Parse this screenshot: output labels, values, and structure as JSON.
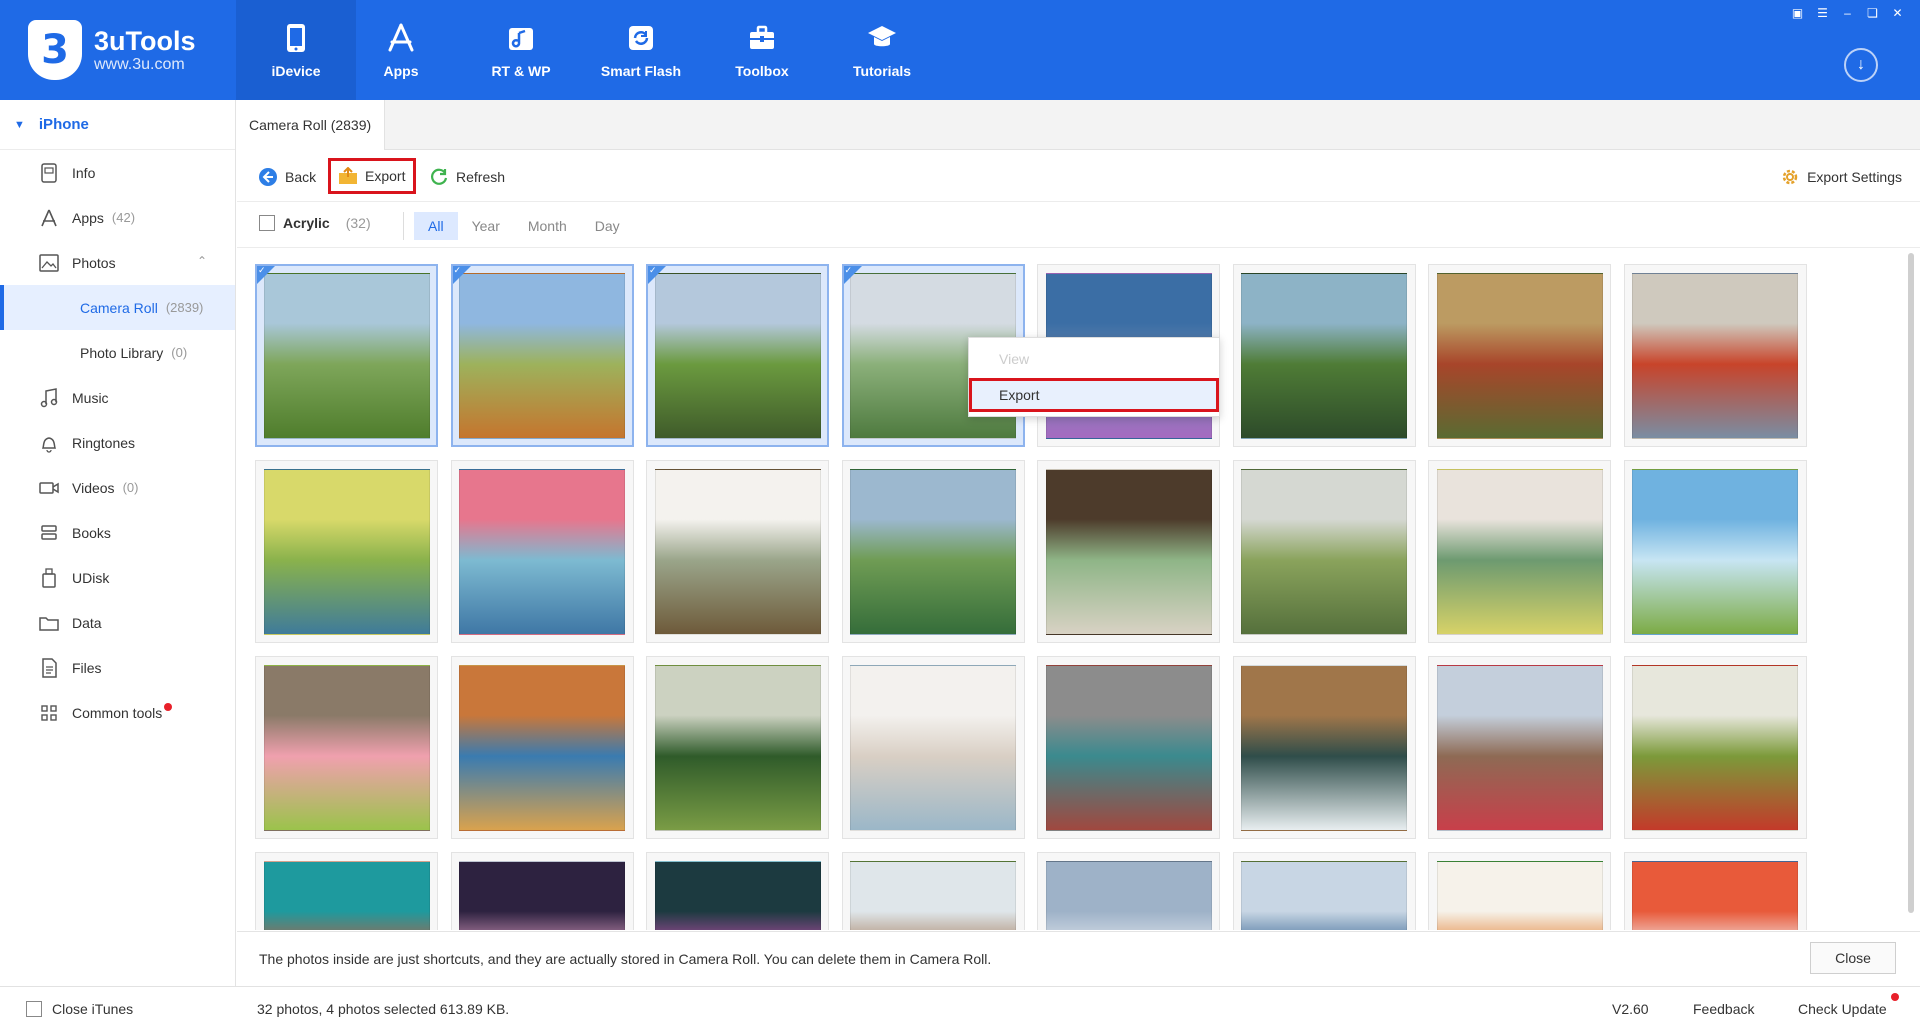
{
  "app": {
    "name": "3uTools",
    "url": "www.3u.com",
    "logo_glyph": "3",
    "brand_color": "#1f6ae6"
  },
  "nav": [
    {
      "label": "iDevice",
      "icon": "phone-icon",
      "active": true
    },
    {
      "label": "Apps",
      "icon": "app-store-icon"
    },
    {
      "label": "RT & WP",
      "icon": "ringtone-wallpaper-icon"
    },
    {
      "label": "Smart Flash",
      "icon": "flash-icon"
    },
    {
      "label": "Toolbox",
      "icon": "toolbox-icon"
    },
    {
      "label": "Tutorials",
      "icon": "graduation-cap-icon"
    }
  ],
  "sidebar": {
    "device": "iPhone",
    "items": [
      {
        "label": "Info",
        "count": "",
        "icon": "info-icon"
      },
      {
        "label": "Apps",
        "count": "(42)",
        "icon": "apps-icon"
      },
      {
        "label": "Photos",
        "count": "",
        "icon": "photos-icon"
      },
      {
        "label": "Camera Roll",
        "count": "(2839)"
      },
      {
        "label": "Photo Library",
        "count": "(0)"
      },
      {
        "label": "Music",
        "count": "",
        "icon": "music-icon"
      },
      {
        "label": "Ringtones",
        "count": "",
        "icon": "bell-icon"
      },
      {
        "label": "Videos",
        "count": "(0)",
        "icon": "video-icon"
      },
      {
        "label": "Books",
        "count": "",
        "icon": "book-icon"
      },
      {
        "label": "UDisk",
        "count": "",
        "icon": "udisk-icon"
      },
      {
        "label": "Data",
        "count": "",
        "icon": "folder-icon"
      },
      {
        "label": "Files",
        "count": "",
        "icon": "file-icon"
      },
      {
        "label": "Common tools",
        "count": "",
        "icon": "grid-icon"
      }
    ]
  },
  "tab": {
    "label": "Camera Roll (2839)"
  },
  "toolbar": {
    "back": "Back",
    "export": "Export",
    "refresh": "Refresh",
    "export_settings": "Export Settings"
  },
  "filter": {
    "album": "Acrylic",
    "count": "(32)",
    "segments": [
      "All",
      "Year",
      "Month",
      "Day"
    ],
    "active_segment": "All"
  },
  "context_menu": {
    "items": [
      "View",
      "Export"
    ]
  },
  "photos": [
    {
      "name": "photo-1",
      "selected": true,
      "colors": [
        "#a9c7d9",
        "#7ea65a",
        "#4f7d2c"
      ]
    },
    {
      "name": "photo-2",
      "selected": true,
      "colors": [
        "#8fb7e0",
        "#9db25c",
        "#c5752e"
      ]
    },
    {
      "name": "photo-3",
      "selected": true,
      "colors": [
        "#b4c8dc",
        "#6b9a3f",
        "#3f5b2a"
      ]
    },
    {
      "name": "photo-4",
      "selected": true,
      "colors": [
        "#d4dbe2",
        "#8bb07a",
        "#4e7a3f"
      ]
    },
    {
      "name": "photo-5",
      "selected": false,
      "colors": [
        "#3b6ea5",
        "#6f8ab0",
        "#a56bc1"
      ]
    },
    {
      "name": "photo-6",
      "selected": false,
      "colors": [
        "#8db3c6",
        "#4f7c36",
        "#2d4b2a"
      ]
    },
    {
      "name": "photo-7",
      "selected": false,
      "colors": [
        "#bc9b62",
        "#a8452a",
        "#5a6b32"
      ]
    },
    {
      "name": "photo-8",
      "selected": false,
      "colors": [
        "#cfc9be",
        "#c8442a",
        "#7a8da3"
      ]
    },
    {
      "name": "photo-9",
      "selected": false,
      "colors": [
        "#d8d96a",
        "#8ab24c",
        "#3f7b9a"
      ]
    },
    {
      "name": "photo-10",
      "selected": false,
      "colors": [
        "#e7768d",
        "#7dbad1",
        "#3f77a5"
      ]
    },
    {
      "name": "photo-11",
      "selected": false,
      "colors": [
        "#f4f2ee",
        "#9aa58a",
        "#6e5a3a"
      ]
    },
    {
      "name": "photo-12",
      "selected": false,
      "colors": [
        "#9cb8cf",
        "#6f9c54",
        "#356d3a"
      ]
    },
    {
      "name": "photo-13",
      "selected": false,
      "colors": [
        "#4d3b2b",
        "#8fb587",
        "#d8d2c4"
      ]
    },
    {
      "name": "photo-14",
      "selected": false,
      "colors": [
        "#d5d8d2",
        "#8aa35c",
        "#55703c"
      ]
    },
    {
      "name": "photo-15",
      "selected": false,
      "colors": [
        "#e9e3dc",
        "#6d9a70",
        "#d7d268"
      ]
    },
    {
      "name": "photo-16",
      "selected": false,
      "colors": [
        "#6fb2e0",
        "#c7e5f3",
        "#7cab45"
      ]
    },
    {
      "name": "photo-17",
      "selected": false,
      "colors": [
        "#8a7a68",
        "#f0a0ae",
        "#9bc34b"
      ]
    },
    {
      "name": "photo-18",
      "selected": false,
      "colors": [
        "#c9773a",
        "#3a7bb0",
        "#d9a24e"
      ]
    },
    {
      "name": "photo-19",
      "selected": false,
      "colors": [
        "#ccd2c1",
        "#2f5b2a",
        "#7a9c45"
      ]
    },
    {
      "name": "photo-20",
      "selected": false,
      "colors": [
        "#f3f1ee",
        "#d9cfc4",
        "#9bb7c8"
      ]
    },
    {
      "name": "photo-21",
      "selected": false,
      "colors": [
        "#8c8c8c",
        "#3b8a8e",
        "#a0483f"
      ]
    },
    {
      "name": "photo-22",
      "selected": false,
      "colors": [
        "#a0764a",
        "#2f4d4a",
        "#e8eef0"
      ]
    },
    {
      "name": "photo-23",
      "selected": false,
      "colors": [
        "#c4cfdc",
        "#8e6a54",
        "#c83f4a"
      ]
    },
    {
      "name": "photo-24",
      "selected": false,
      "colors": [
        "#e7e7dc",
        "#7c9a3a",
        "#c33a2a"
      ]
    },
    {
      "name": "photo-25",
      "selected": false,
      "colors": [
        "#1e9a9e",
        "#c25a3c",
        "#e9b19c"
      ]
    },
    {
      "name": "photo-26",
      "selected": false,
      "colors": [
        "#2d2240",
        "#e0a0c4",
        "#cfd6e4"
      ]
    },
    {
      "name": "photo-27",
      "selected": false,
      "colors": [
        "#1c3a40",
        "#c44fb0",
        "#8fd0e0"
      ]
    },
    {
      "name": "photo-28",
      "selected": false,
      "colors": [
        "#dfe6ea",
        "#a27a5a",
        "#5c7e3a"
      ]
    },
    {
      "name": "photo-29",
      "selected": false,
      "colors": [
        "#9eb2c8",
        "#e3e8ee",
        "#6c7f96"
      ]
    },
    {
      "name": "photo-30",
      "selected": false,
      "colors": [
        "#c8d6e4",
        "#2f5e8e",
        "#5d7a3a"
      ]
    },
    {
      "name": "photo-31",
      "selected": false,
      "colors": [
        "#f6f2ea",
        "#e17a2a",
        "#3e8c3a"
      ]
    },
    {
      "name": "photo-32",
      "selected": false,
      "colors": [
        "#e85a3a",
        "#f4f6f8",
        "#4a6ea0"
      ]
    }
  ],
  "footer": {
    "message": "The photos inside are just shortcuts, and they are actually stored in Camera Roll. You can delete them in Camera Roll.",
    "close": "Close"
  },
  "statusbar": {
    "close_itunes": "Close iTunes",
    "summary": "32 photos, 4 photos selected 613.89 KB.",
    "version": "V2.60",
    "feedback": "Feedback",
    "check_update": "Check Update"
  },
  "colors": {
    "highlight_red": "#d9141c",
    "selection_blue": "#8db3ee",
    "notification_dot": "#e8202a"
  }
}
